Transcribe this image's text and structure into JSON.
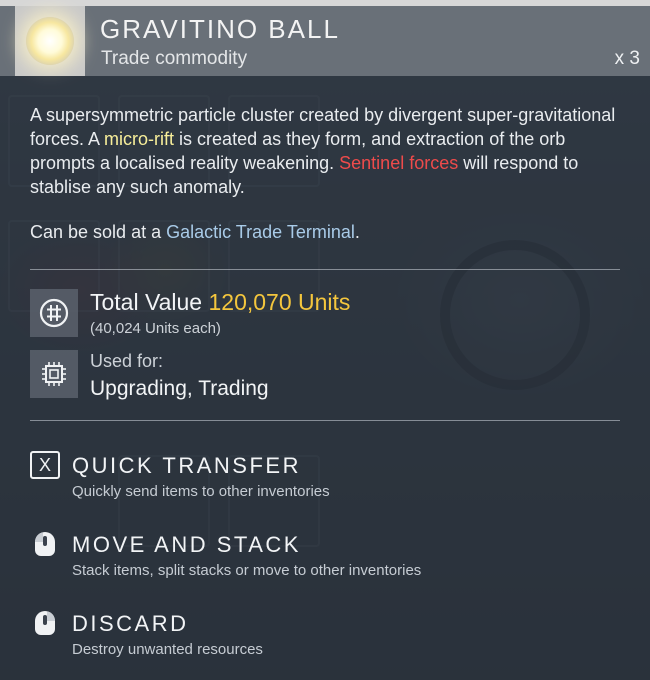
{
  "item": {
    "name": "GRAVITINO BALL",
    "category": "Trade commodity",
    "quantity": "x 3",
    "icon": "gravitino-orb-icon"
  },
  "description": {
    "part1": "A supersymmetric particle cluster created by divergent super-gravitational forces. A ",
    "highlight1": "micro-rift",
    "part2": " is created as they form, and extraction of the orb prompts a localised reality weakening. ",
    "highlight2": "Sentinel forces",
    "part3": " will respond to stablise any such anomaly."
  },
  "sale": {
    "prefix": "Can be sold at a ",
    "terminal": "Galactic Trade Terminal",
    "suffix": "."
  },
  "value": {
    "label": "Total Value",
    "total": "120,070 Units",
    "each": "(40,024 Units each)",
    "icon": "units-currency-icon"
  },
  "usage": {
    "label": "Used for:",
    "value": "Upgrading, Trading",
    "icon": "chip-icon"
  },
  "actions": [
    {
      "key": "X",
      "title": "QUICK TRANSFER",
      "desc": "Quickly send items to other inventories",
      "icon": "key-x-icon"
    },
    {
      "title": "MOVE AND STACK",
      "desc": "Stack items, split stacks or move to other inventories",
      "icon": "mouse-icon"
    },
    {
      "title": "DISCARD",
      "desc": "Destroy unwanted resources",
      "icon": "mouse-icon"
    }
  ],
  "colors": {
    "highlight_yellow": "#f7ee9a",
    "highlight_red": "#ee4b4b",
    "highlight_blue": "#a9cbe8",
    "value_gold": "#f4c63d"
  }
}
